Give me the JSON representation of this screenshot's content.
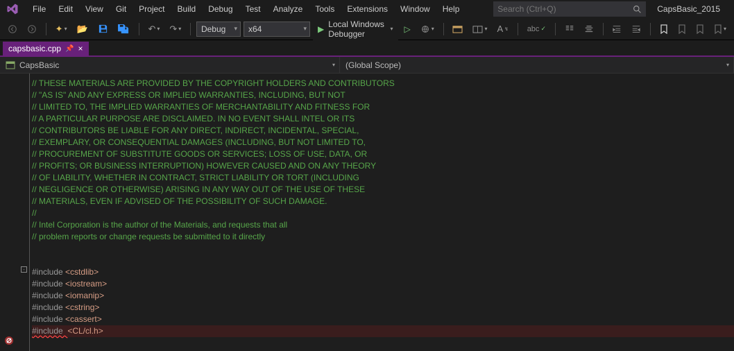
{
  "menubar": {
    "items": [
      "File",
      "Edit",
      "View",
      "Git",
      "Project",
      "Build",
      "Debug",
      "Test",
      "Analyze",
      "Tools",
      "Extensions",
      "Window",
      "Help"
    ],
    "search_placeholder": "Search (Ctrl+Q)",
    "project_name": "CapsBasic_2015"
  },
  "toolbar": {
    "config": "Debug",
    "platform": "x64",
    "debugger_label": "Local Windows Debugger"
  },
  "tab": {
    "file": "capsbasic.cpp"
  },
  "nav": {
    "project": "CapsBasic",
    "scope": "(Global Scope)"
  },
  "code": {
    "comments": [
      "// THESE MATERIALS ARE PROVIDED BY THE COPYRIGHT HOLDERS AND CONTRIBUTORS",
      "// \"AS IS\" AND ANY EXPRESS OR IMPLIED WARRANTIES, INCLUDING, BUT NOT",
      "// LIMITED TO, THE IMPLIED WARRANTIES OF MERCHANTABILITY AND FITNESS FOR",
      "// A PARTICULAR PURPOSE ARE DISCLAIMED. IN NO EVENT SHALL INTEL OR ITS",
      "// CONTRIBUTORS BE LIABLE FOR ANY DIRECT, INDIRECT, INCIDENTAL, SPECIAL,",
      "// EXEMPLARY, OR CONSEQUENTIAL DAMAGES (INCLUDING, BUT NOT LIMITED TO,",
      "// PROCUREMENT OF SUBSTITUTE GOODS OR SERVICES; LOSS OF USE, DATA, OR",
      "// PROFITS; OR BUSINESS INTERRUPTION) HOWEVER CAUSED AND ON ANY THEORY",
      "// OF LIABILITY, WHETHER IN CONTRACT, STRICT LIABILITY OR TORT (INCLUDING",
      "// NEGLIGENCE OR OTHERWISE) ARISING IN ANY WAY OUT OF THE USE OF THESE",
      "// MATERIALS, EVEN IF ADVISED OF THE POSSIBILITY OF SUCH DAMAGE.",
      "//",
      "// Intel Corporation is the author of the Materials, and requests that all",
      "// problem reports or change requests be submitted to it directly"
    ],
    "includes": [
      {
        "pp": "#include ",
        "hdr": "<cstdlib>"
      },
      {
        "pp": "#include ",
        "hdr": "<iostream>"
      },
      {
        "pp": "#include ",
        "hdr": "<iomanip>"
      },
      {
        "pp": "#include ",
        "hdr": "<cstring>"
      },
      {
        "pp": "#include ",
        "hdr": "<cassert>"
      }
    ],
    "err_include": {
      "pp": "#include  ",
      "hdr": "<CL/cl.h>"
    }
  },
  "fold": {
    "expand": "+",
    "collapse": "-"
  }
}
